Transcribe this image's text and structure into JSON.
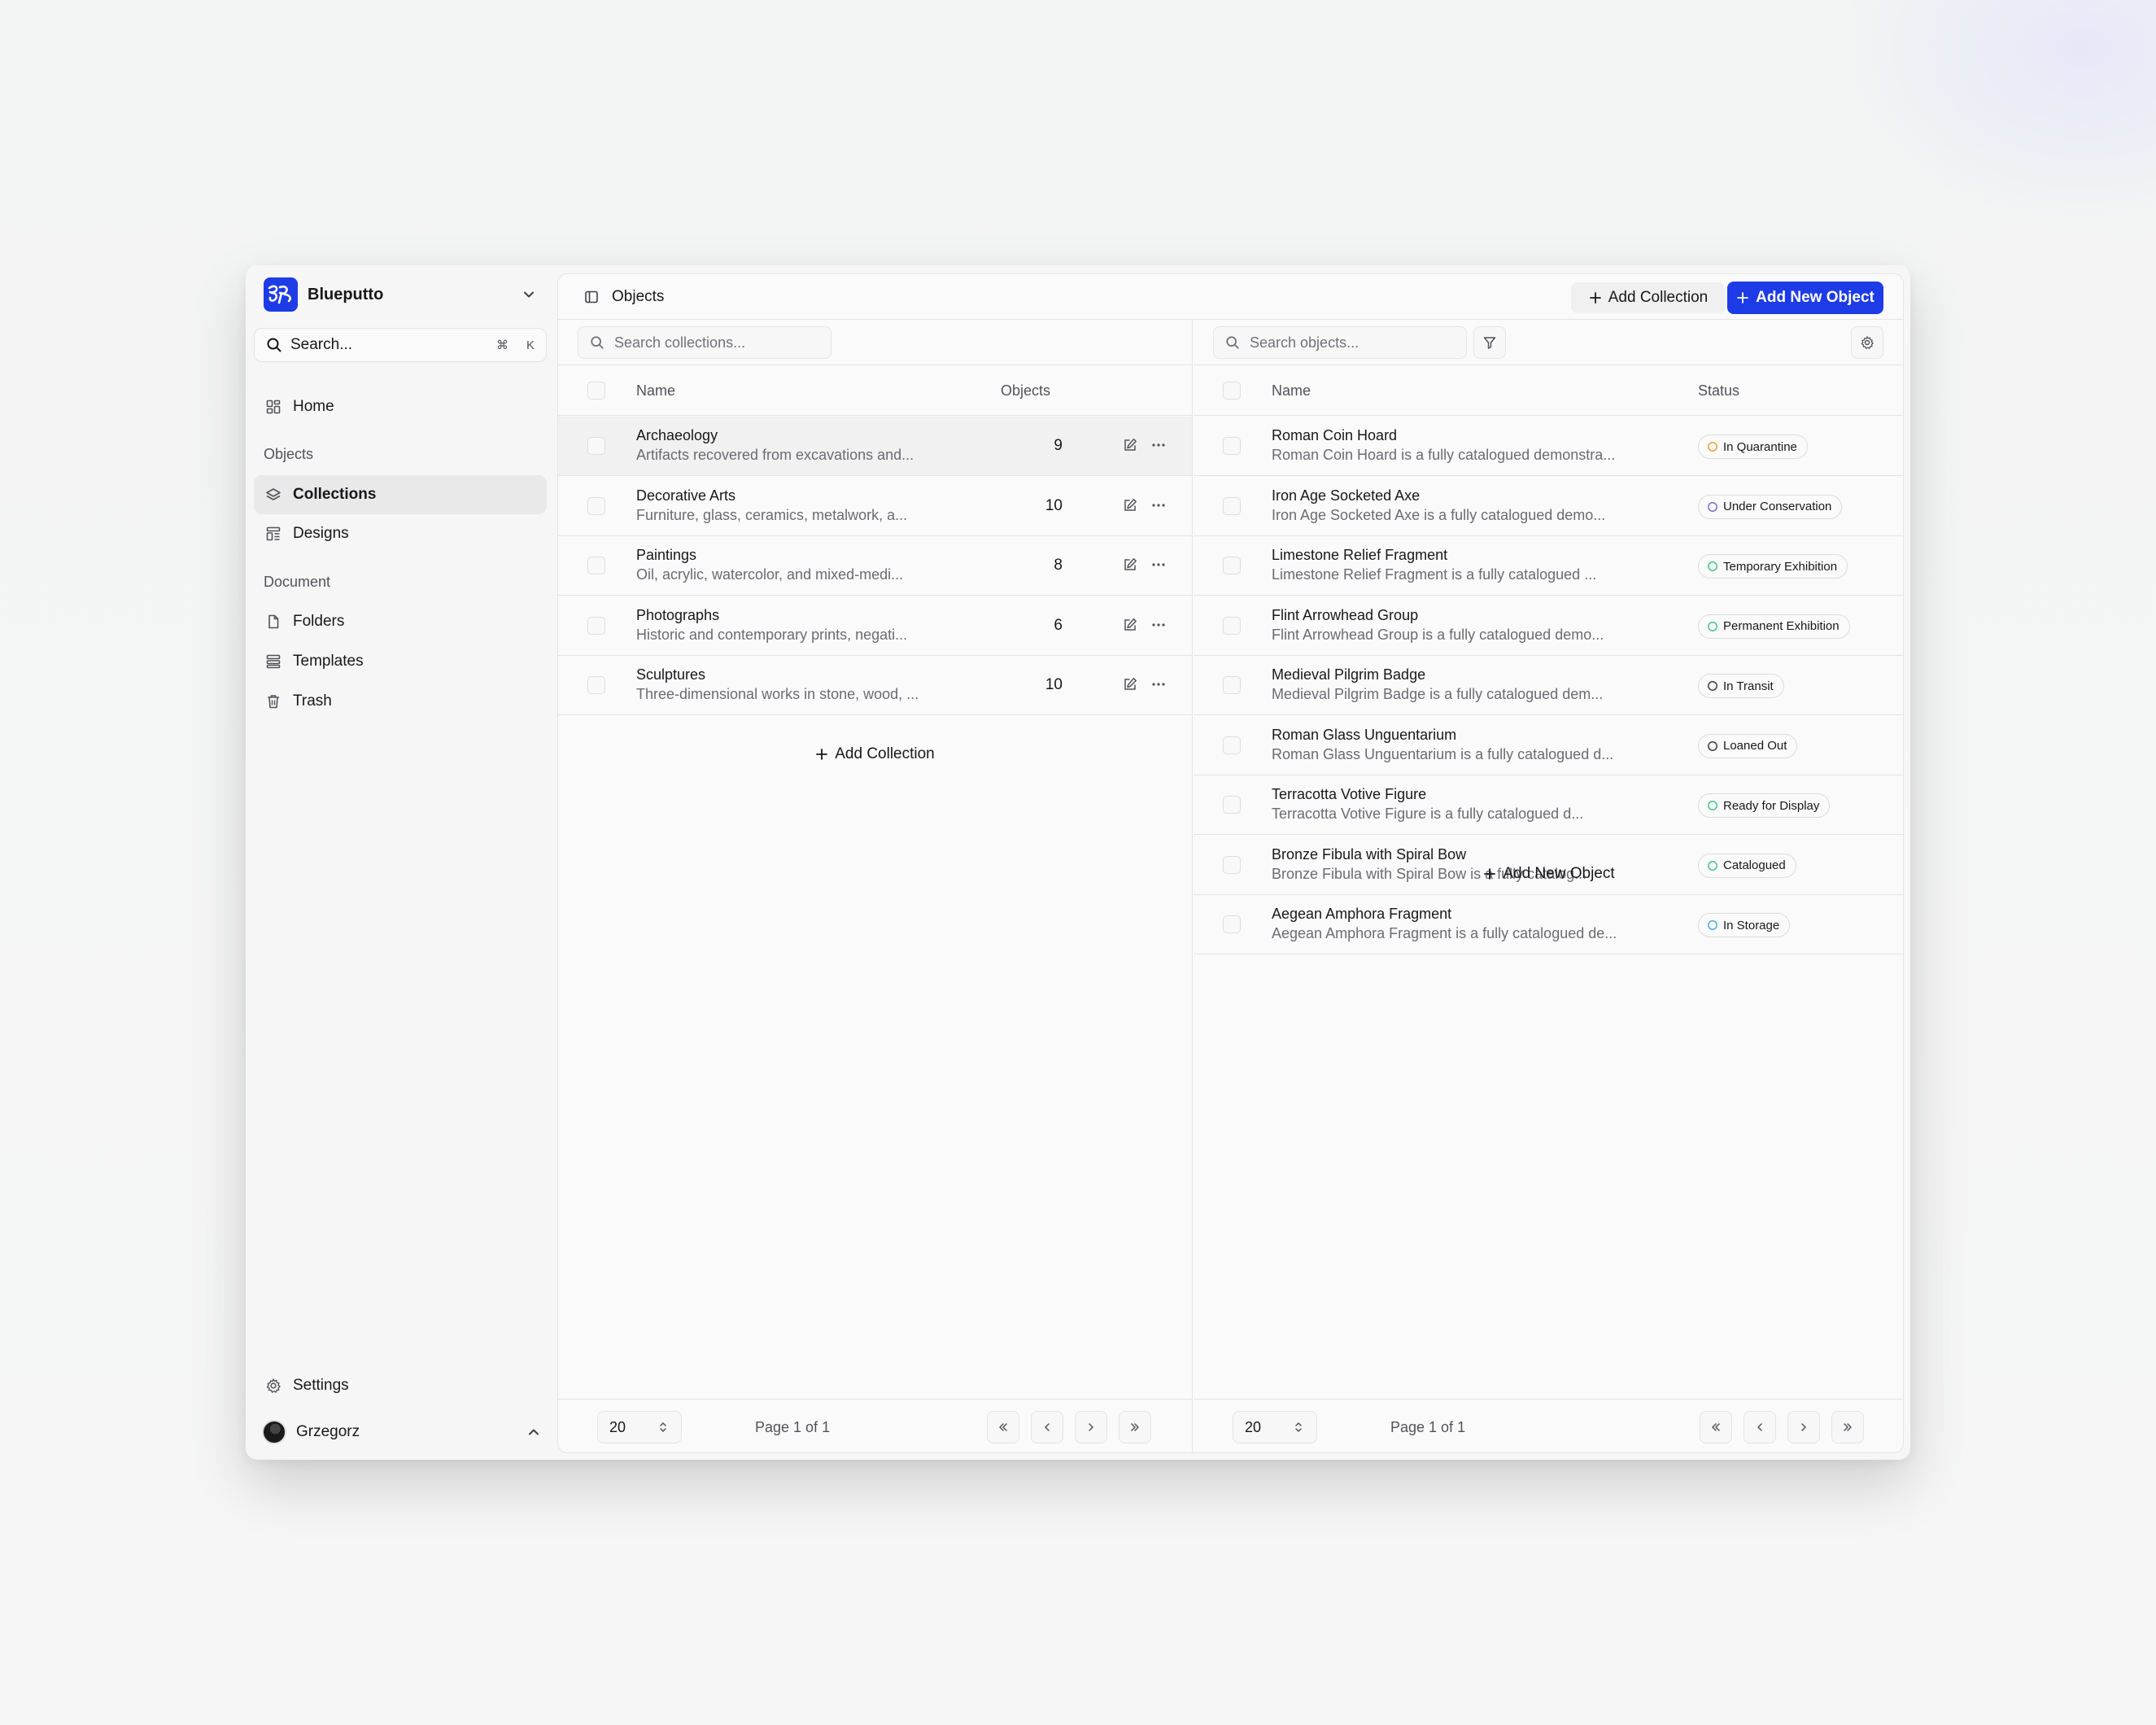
{
  "app": {
    "name": "Blueputto",
    "user": "Grzegorz",
    "accent": "#1d3be6"
  },
  "sidebar": {
    "search_placeholder": "Search...",
    "shortcut_cmd": "⌘",
    "shortcut_key": "K",
    "home": "Home",
    "section_objects": "Objects",
    "collections": "Collections",
    "designs": "Designs",
    "section_document": "Document",
    "folders": "Folders",
    "templates": "Templates",
    "trash": "Trash",
    "settings": "Settings"
  },
  "header": {
    "title": "Objects",
    "add_collection": "Add Collection",
    "add_new_object": "Add New Object"
  },
  "collections": {
    "search_placeholder": "Search collections...",
    "col_name": "Name",
    "col_objects": "Objects",
    "rows": [
      {
        "name": "Archaeology",
        "desc": "Artifacts recovered from excavations and...",
        "count": "9"
      },
      {
        "name": "Decorative Arts",
        "desc": "Furniture, glass, ceramics, metalwork, a...",
        "count": "10"
      },
      {
        "name": "Paintings",
        "desc": "Oil, acrylic, watercolor, and mixed-medi...",
        "count": "8"
      },
      {
        "name": "Photographs",
        "desc": "Historic and contemporary prints, negati...",
        "count": "6"
      },
      {
        "name": "Sculptures",
        "desc": "Three-dimensional works in stone, wood, ...",
        "count": "10"
      }
    ],
    "add_label": "Add Collection",
    "page_size": "20",
    "page_text": "Page 1 of 1"
  },
  "objects": {
    "search_placeholder": "Search objects...",
    "col_name": "Name",
    "col_status": "Status",
    "rows": [
      {
        "name": "Roman Coin Hoard",
        "desc": "Roman Coin Hoard is a fully catalogued demonstra...",
        "status": "In Quarantine",
        "status_color": "#e9a23b"
      },
      {
        "name": "Iron Age Socketed Axe",
        "desc": "Iron Age Socketed Axe is a fully catalogued demo...",
        "status": "Under Conservation",
        "status_color": "#7b6fd6"
      },
      {
        "name": "Limestone Relief Fragment",
        "desc": "Limestone Relief Fragment is a fully catalogued ...",
        "status": "Temporary Exhibition",
        "status_color": "#4cc38a"
      },
      {
        "name": "Flint Arrowhead Group",
        "desc": "Flint Arrowhead Group is a fully catalogued demo...",
        "status": "Permanent Exhibition",
        "status_color": "#4cc38a"
      },
      {
        "name": "Medieval Pilgrim Badge",
        "desc": "Medieval Pilgrim Badge is a fully catalogued dem...",
        "status": "In Transit",
        "status_color": "#3f3f46"
      },
      {
        "name": "Roman Glass Unguentarium",
        "desc": "Roman Glass Unguentarium is a fully catalogued d...",
        "status": "Loaned Out",
        "status_color": "#3f3f46"
      },
      {
        "name": "Terracotta Votive Figure",
        "desc": "Terracotta Votive Figure is a fully catalogued d...",
        "status": "Ready for Display",
        "status_color": "#4cc38a"
      },
      {
        "name": "Bronze Fibula with Spiral Bow",
        "desc": "Bronze Fibula with Spiral Bow is a fully catalog...",
        "status": "Catalogued",
        "status_color": "#4cc38a"
      },
      {
        "name": "Aegean Amphora Fragment",
        "desc": "Aegean Amphora Fragment is a fully catalogued de...",
        "status": "In Storage",
        "status_color": "#4ab0d9"
      }
    ],
    "add_label": "Add New Object",
    "page_size": "20",
    "page_text": "Page 1 of 1"
  }
}
